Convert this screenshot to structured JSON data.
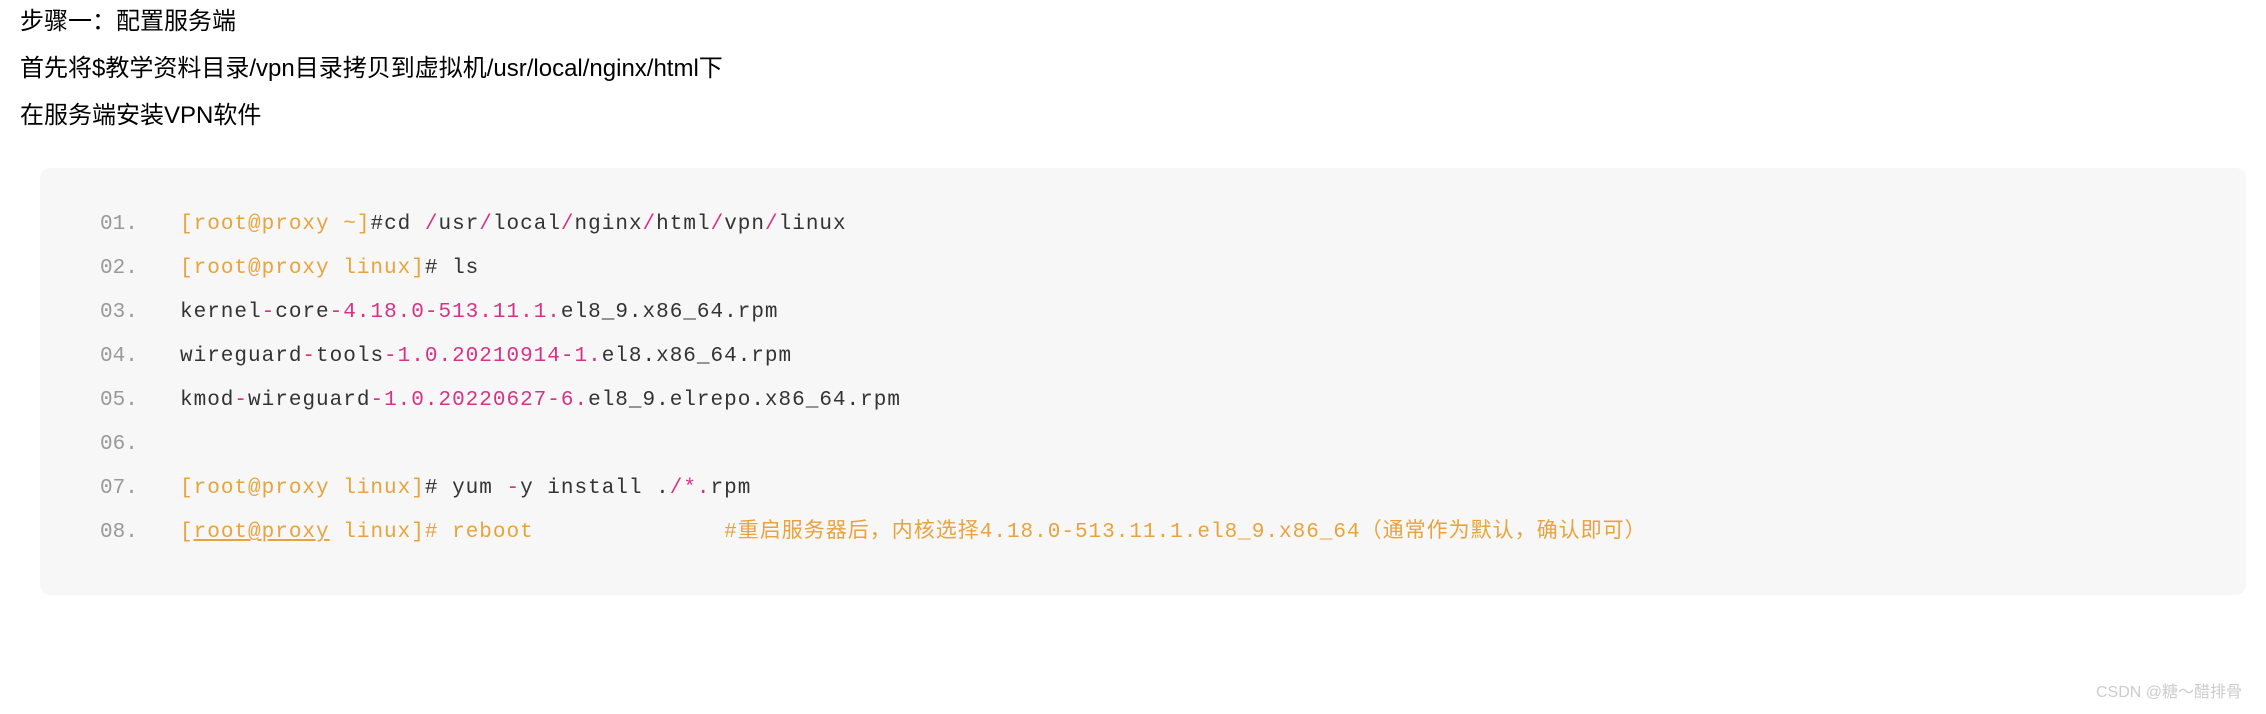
{
  "intro": {
    "line1": "步骤一：配置服务端",
    "line2": "首先将$教学资料目录/vpn目录拷贝到虚拟机/usr/local/nginx/html下",
    "line3": "在服务端安装VPN软件"
  },
  "code": {
    "lines": [
      {
        "num": "01.",
        "prefix_open": "[",
        "user": "root@proxy ",
        "tilde": "~",
        "prefix_close": "]",
        "hash": "#",
        "cmd": "cd ",
        "arg_plain": "",
        "path": "/usr/local/nginx/html/vpn/linux"
      },
      {
        "num": "02.",
        "prefix_open": "[",
        "user": "root@proxy linux",
        "prefix_close": "]",
        "hash": "#",
        "cmd": " ls"
      },
      {
        "num": "03.",
        "plain1": "kernel",
        "dash1": "-",
        "plain2": "core",
        "dash2": "-",
        "ver": "4.18.0-513.11.1.",
        "suffix": "el8_9.x86_64.rpm"
      },
      {
        "num": "04.",
        "plain1": "wireguard",
        "dash1": "-",
        "plain2": "tools",
        "dash2": "-",
        "ver": "1.0.20210914-1.",
        "suffix": "el8.x86_64.rpm"
      },
      {
        "num": "05.",
        "plain1": "kmod",
        "dash1": "-",
        "plain2": "wireguard",
        "dash2": "-",
        "ver": "1.0.20220627-6.",
        "suffix": "el8_9.elrepo.x86_64.rpm"
      },
      {
        "num": "06.",
        "empty": true
      },
      {
        "num": "07.",
        "prefix_open": "[",
        "user": "root@proxy linux",
        "prefix_close": "]",
        "hash": "#",
        "cmd": " yum ",
        "flag": "-",
        "cmd2": "y install .",
        "slash": "/*.",
        "ext": "rpm"
      },
      {
        "num": "08.",
        "all_orange": true,
        "prefix_open": "[",
        "user_link": "root@proxy",
        "user2": " linux",
        "prefix_close": "]",
        "hash": "#",
        "cmd": " reboot              ",
        "comment": "#重启服务器后，内核选择4.18.0-513.11.1.el8_9.x86_64（通常作为默认，确认即可）"
      }
    ]
  },
  "watermark": "CSDN @糖～醋排骨"
}
